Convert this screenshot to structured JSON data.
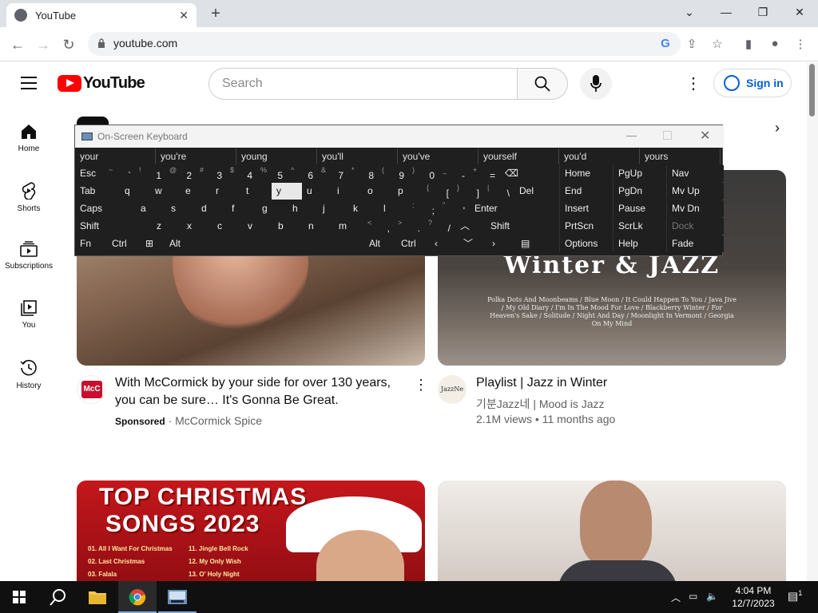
{
  "browser": {
    "tab_title": "YouTube",
    "url": "youtube.com",
    "new_tab": "+",
    "win_min": "—",
    "win_restore": "❐",
    "win_close": "✕",
    "tab_list": "⌄"
  },
  "youtube": {
    "logo_text": "YouTube",
    "search_placeholder": "Search",
    "sign_in": "Sign in",
    "sidebar": [
      {
        "label": "Home"
      },
      {
        "label": "Shorts"
      },
      {
        "label": "Subscriptions"
      },
      {
        "label": "You"
      },
      {
        "label": "History"
      }
    ],
    "videos": [
      {
        "title": "With McCormick by your side for over 130 years, you can be sure… It's Gonna Be Great.",
        "sponsored": "Sponsored",
        "channel": "McCormick Spice"
      },
      {
        "title": "Playlist | Jazz in Winter",
        "channel": "기분Jazz네 | Mood is Jazz",
        "meta": "2.1M views • 11 months ago",
        "thumb_title": "Winter & JAZZ",
        "thumb_songs": "Polka Dots And Moonbeams / Blue Moon / It Could Happen To You / Java Jive / My Old Diary / I'm In The Mood For Love / Blackberry Winter / For Heaven's Sake / Solitude / Night And Day / Moonlight In Vermont / Georgia On My Mind",
        "avatar_text": "JazzNe"
      },
      {
        "thumb_line1": "TOP CHRISTMAS",
        "thumb_line2": "SONGS 2023",
        "thumb_list_a": [
          "01. All I Want For Christmas",
          "02. Last Christmas",
          "03. Falala"
        ],
        "thumb_list_b": [
          "11. Jingle Bell Rock",
          "12. My Only Wish",
          "13. O' Holy Night"
        ]
      },
      {}
    ],
    "avatar_mc": "McC"
  },
  "osk": {
    "title": "On-Screen Keyboard",
    "predictions": [
      "your",
      "you're",
      "young",
      "you'll",
      "you've",
      "yourself",
      "you'd",
      "yours"
    ],
    "rows": [
      [
        {
          "m": "Esc"
        },
        {
          "s": "~",
          "m": "`"
        },
        {
          "s": "!",
          "m": "1"
        },
        {
          "s": "@",
          "m": "2"
        },
        {
          "s": "#",
          "m": "3"
        },
        {
          "s": "$",
          "m": "4"
        },
        {
          "s": "%",
          "m": "5"
        },
        {
          "s": "^",
          "m": "6"
        },
        {
          "s": "&",
          "m": "7"
        },
        {
          "s": "*",
          "m": "8"
        },
        {
          "s": "(",
          "m": "9"
        },
        {
          "s": ")",
          "m": "0"
        },
        {
          "s": "_",
          "m": "-"
        },
        {
          "s": "+",
          "m": "="
        },
        {
          "m": "⌫"
        }
      ],
      [
        {
          "m": "Tab"
        },
        {
          "m": "q"
        },
        {
          "m": "w"
        },
        {
          "m": "e"
        },
        {
          "m": "r"
        },
        {
          "m": "t"
        },
        {
          "m": "y"
        },
        {
          "m": "u"
        },
        {
          "m": "i"
        },
        {
          "m": "o"
        },
        {
          "m": "p"
        },
        {
          "s": "{",
          "m": "["
        },
        {
          "s": "}",
          "m": "]"
        },
        {
          "s": "|",
          "m": "\\"
        },
        {
          "m": "Del"
        }
      ],
      [
        {
          "m": "Caps"
        },
        {
          "m": "a"
        },
        {
          "m": "s"
        },
        {
          "m": "d"
        },
        {
          "m": "f"
        },
        {
          "m": "g"
        },
        {
          "m": "h"
        },
        {
          "m": "j"
        },
        {
          "m": "k"
        },
        {
          "m": "l"
        },
        {
          "s": ":",
          "m": ";"
        },
        {
          "s": "\"",
          "m": "'"
        },
        {
          "m": "Enter"
        }
      ],
      [
        {
          "m": "Shift"
        },
        {
          "m": "z"
        },
        {
          "m": "x"
        },
        {
          "m": "c"
        },
        {
          "m": "v"
        },
        {
          "m": "b"
        },
        {
          "m": "n"
        },
        {
          "m": "m"
        },
        {
          "s": "<",
          "m": ","
        },
        {
          "s": ">",
          "m": "."
        },
        {
          "s": "?",
          "m": "/"
        },
        {
          "m": "︿"
        },
        {
          "m": "Shift"
        }
      ],
      [
        {
          "m": "Fn"
        },
        {
          "m": "Ctrl"
        },
        {
          "m": "⊞"
        },
        {
          "m": "Alt"
        },
        {
          "m": "Alt"
        },
        {
          "m": "Ctrl"
        },
        {
          "m": "‹"
        },
        {
          "m": "﹀"
        },
        {
          "m": "›"
        },
        {
          "m": "▤"
        }
      ]
    ],
    "nav_keys": [
      [
        "Home",
        "PgUp",
        "Nav"
      ],
      [
        "End",
        "PgDn",
        "Mv Up"
      ],
      [
        "Insert",
        "Pause",
        "Mv Dn"
      ],
      [
        "PrtScn",
        "ScrLk",
        "Dock"
      ],
      [
        "Options",
        "Help",
        "Fade"
      ]
    ]
  },
  "taskbar": {
    "time": "4:04 PM",
    "date": "12/7/2023",
    "notif_count": "1"
  },
  "colors": {
    "yt_red": "#ff0000",
    "link_blue": "#065fd4",
    "osk_bg": "#1f1f1f"
  }
}
